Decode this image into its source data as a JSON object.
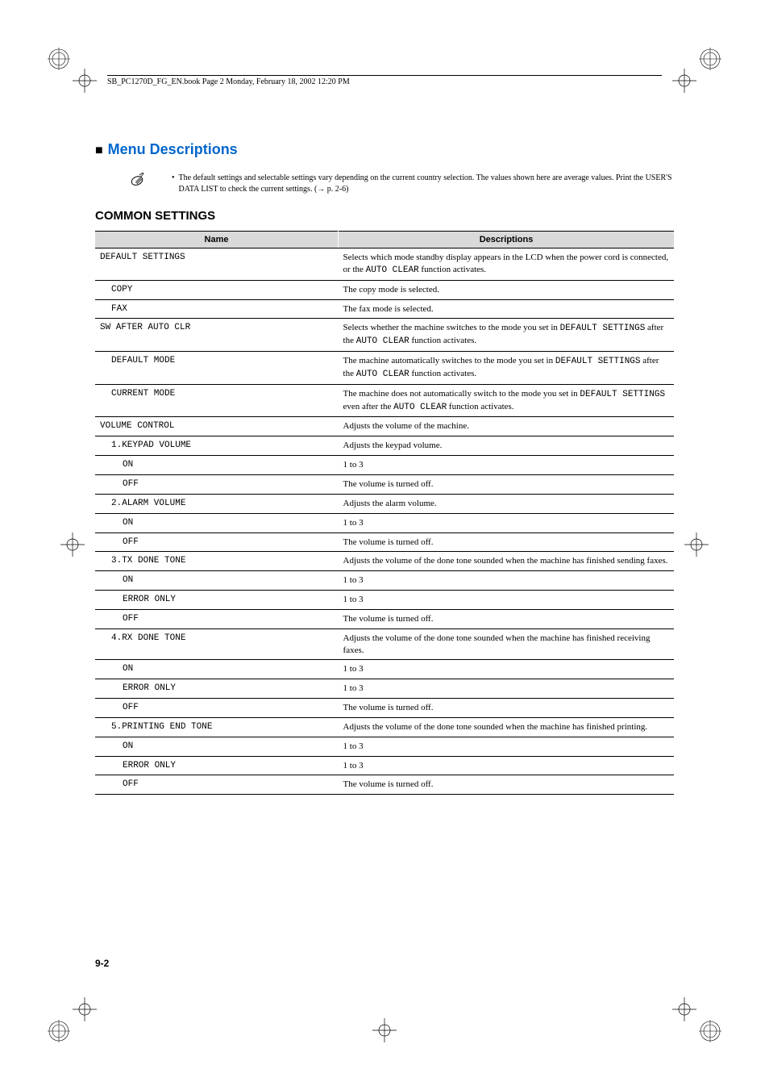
{
  "header": "SB_PC1270D_FG_EN.book  Page 2  Monday, February 18, 2002  12:20 PM",
  "section_title_prefix": "■",
  "section_title": "Menu Descriptions",
  "note_text": "The default settings and selectable settings vary depending on the current country selection. The values shown here are average values. Print the USER'S DATA LIST to check the current settings. (→ p. 2-6)",
  "subsection_title": "COMMON SETTINGS",
  "head_name": "Name",
  "head_desc": "Descriptions",
  "rows": {
    "r0": {
      "name": "DEFAULT SETTINGS",
      "desc_pre": "Selects which mode standby display appears in the LCD when the power cord is connected, or the ",
      "desc_mono": "AUTO CLEAR",
      "desc_post": " function activates."
    },
    "r1": {
      "name": "COPY",
      "desc": "The copy mode is selected."
    },
    "r2": {
      "name": "FAX",
      "desc": "The fax mode is selected."
    },
    "r3": {
      "name": "SW AFTER AUTO CLR",
      "desc_pre": "Selects whether the machine switches to the mode you set in ",
      "desc_mono1": "DEFAULT SETTINGS",
      "desc_mid": " after the ",
      "desc_mono2": "AUTO CLEAR",
      "desc_post": " function activates."
    },
    "r4": {
      "name": "DEFAULT MODE",
      "desc_pre": "The machine automatically switches to the mode you set in ",
      "desc_mono1": "DEFAULT SETTINGS",
      "desc_mid": " after the ",
      "desc_mono2": "AUTO CLEAR",
      "desc_post": " function activates."
    },
    "r5": {
      "name": "CURRENT MODE",
      "desc_pre": "The machine does not automatically switch to the mode you set in ",
      "desc_mono1": "DEFAULT SETTINGS",
      "desc_mid": " even after the ",
      "desc_mono2": "AUTO CLEAR",
      "desc_post": " function activates."
    },
    "r6": {
      "name": "VOLUME CONTROL",
      "desc": "Adjusts the volume of the machine."
    },
    "r7": {
      "name": "1.KEYPAD VOLUME",
      "desc": "Adjusts the keypad volume."
    },
    "r8": {
      "name": "ON",
      "desc": "1 to 3"
    },
    "r9": {
      "name": "OFF",
      "desc": "The volume is turned off."
    },
    "r10": {
      "name": "2.ALARM VOLUME",
      "desc": "Adjusts the alarm volume."
    },
    "r11": {
      "name": "ON",
      "desc": "1 to 3"
    },
    "r12": {
      "name": "OFF",
      "desc": "The volume is turned off."
    },
    "r13": {
      "name": "3.TX DONE TONE",
      "desc": "Adjusts the volume of the done tone sounded when the machine has finished sending faxes."
    },
    "r14": {
      "name": "ON",
      "desc": "1 to 3"
    },
    "r15": {
      "name": "ERROR ONLY",
      "desc": "1 to 3"
    },
    "r16": {
      "name": "OFF",
      "desc": "The volume is turned off."
    },
    "r17": {
      "name": "4.RX DONE TONE",
      "desc": "Adjusts the volume of the done tone sounded when the machine has finished receiving faxes."
    },
    "r18": {
      "name": "ON",
      "desc": "1 to 3"
    },
    "r19": {
      "name": "ERROR ONLY",
      "desc": "1 to 3"
    },
    "r20": {
      "name": "OFF",
      "desc": "The volume is turned off."
    },
    "r21": {
      "name": "5.PRINTING END TONE",
      "desc": "Adjusts the volume of the done tone sounded when the machine has finished printing."
    },
    "r22": {
      "name": "ON",
      "desc": "1 to 3"
    },
    "r23": {
      "name": "ERROR ONLY",
      "desc": "1 to 3"
    },
    "r24": {
      "name": "OFF",
      "desc": "The volume is turned off."
    }
  },
  "page_number": "9-2"
}
